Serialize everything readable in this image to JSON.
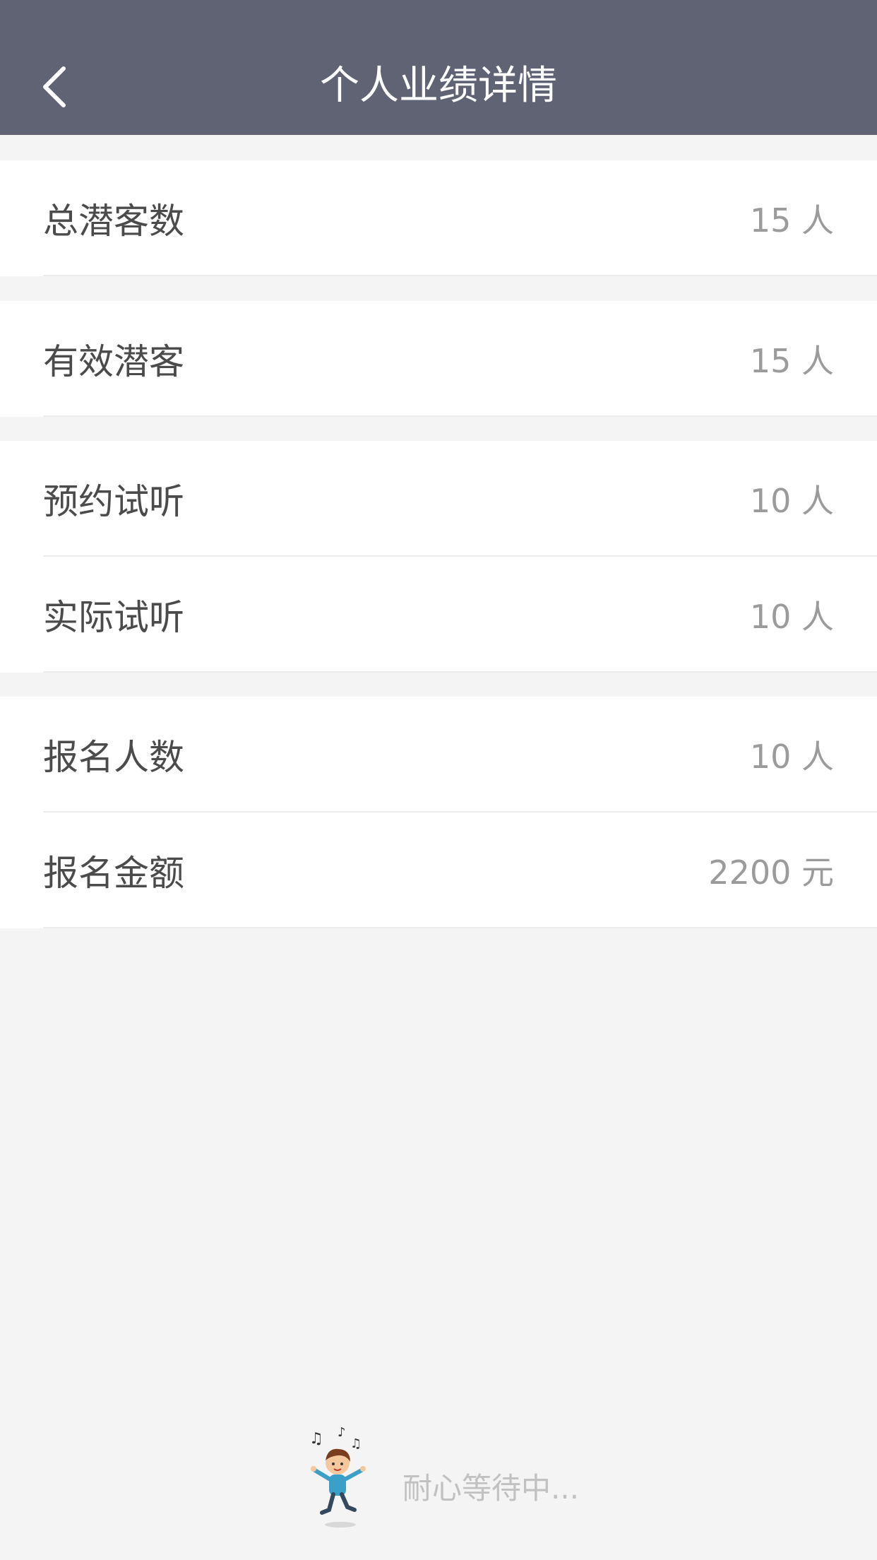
{
  "header": {
    "title": "个人业绩详情",
    "back_icon": "chevron-left-icon"
  },
  "stats": {
    "total_leads": {
      "label": "总潜客数",
      "value": "15 人"
    },
    "valid_leads": {
      "label": "有效潜客",
      "value": "15 人"
    },
    "booked_trial": {
      "label": "预约试听",
      "value": "10 人"
    },
    "actual_trial": {
      "label": "实际试听",
      "value": "10 人"
    },
    "enrolled_count": {
      "label": "报名人数",
      "value": "10 人"
    },
    "enrolled_amount": {
      "label": "报名金额",
      "value": "2200 元"
    }
  },
  "loading": {
    "text": "耐心等待中...",
    "icon": "dancing-kid-icon"
  },
  "colors": {
    "header_bg": "#5f6374",
    "page_bg": "#f4f4f4",
    "label": "#4b4b4b",
    "value": "#9b9b9b"
  }
}
